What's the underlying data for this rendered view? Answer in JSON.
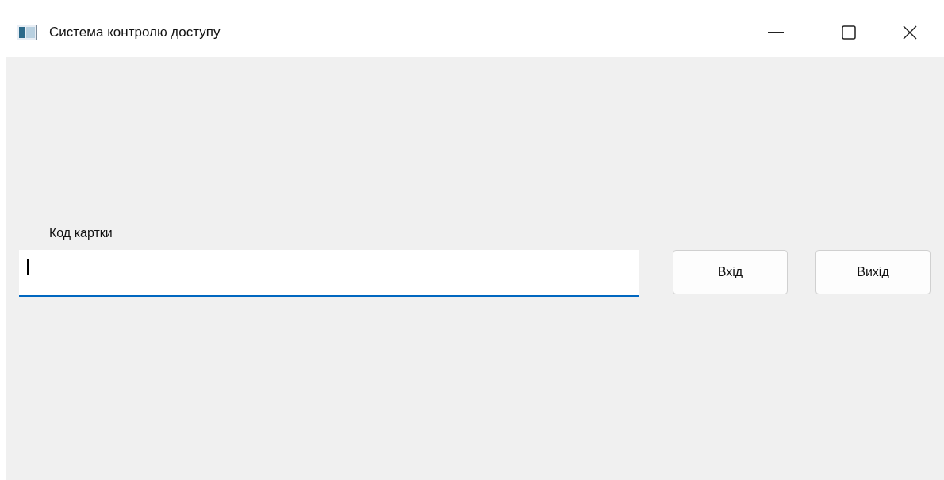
{
  "window": {
    "title": "Система контролю доступу"
  },
  "form": {
    "label": "Код картки",
    "field": {
      "focused": true
    }
  },
  "buttons": [
    {
      "label": "Вхід"
    },
    {
      "label": "Вихід"
    }
  ]
}
